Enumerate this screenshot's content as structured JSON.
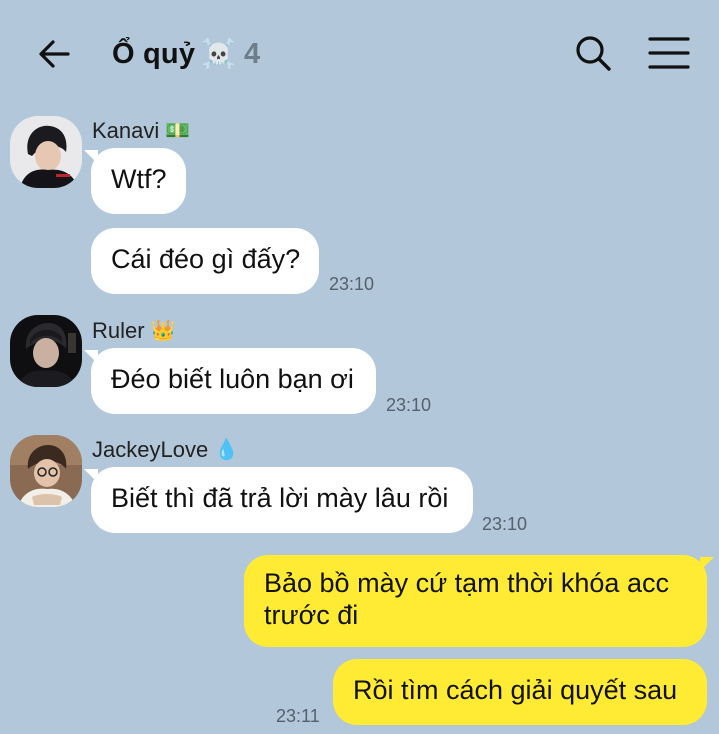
{
  "header": {
    "back_icon": "arrow-left-icon",
    "title": "Ổ quỷ",
    "title_emoji": "☠️",
    "member_count": "4",
    "search_icon": "search-icon",
    "menu_icon": "hamburger-menu-icon"
  },
  "colors": {
    "background": "#b2c7d9",
    "incoming_bubble": "#ffffff",
    "outgoing_bubble": "#ffeb33",
    "timestamp": "#55616c"
  },
  "messages": [
    {
      "sender": "Kanavi",
      "sender_emoji": "💵",
      "direction": "incoming",
      "bubbles": [
        "Wtf?",
        "Cái đéo gì đấy?"
      ],
      "time": "23:10"
    },
    {
      "sender": "Ruler",
      "sender_emoji": "👑",
      "direction": "incoming",
      "bubbles": [
        "Đéo biết luôn bạn ơi"
      ],
      "time": "23:10"
    },
    {
      "sender": "JackeyLove",
      "sender_emoji": "💧",
      "direction": "incoming",
      "bubbles": [
        "Biết thì đã trả lời mày lâu rồi"
      ],
      "time": "23:10"
    },
    {
      "direction": "outgoing",
      "bubbles": [
        "Bảo bồ mày cứ tạm thời khóa acc",
        "trước đi",
        "Rồi tìm cách giải quyết sau"
      ],
      "time": "23:11"
    }
  ]
}
